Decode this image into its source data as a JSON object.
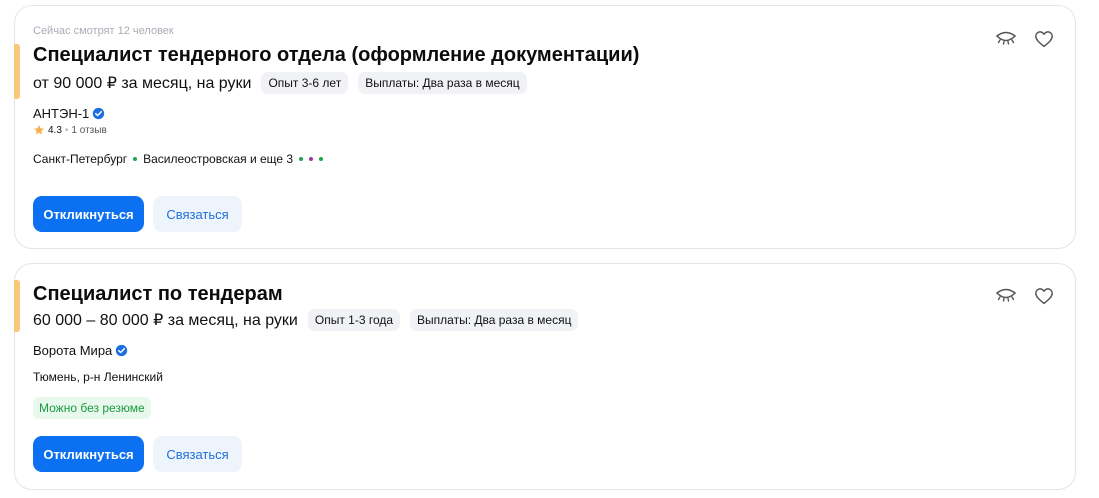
{
  "vacancies": [
    {
      "viewing_now": "Сейчас смотрят 12 человек",
      "title": "Специалист тендерного отдела (оформление документации)",
      "salary": "от 90 000 ₽ за месяц, на руки",
      "experience": "Опыт 3-6 лет",
      "payouts": "Выплаты: Два раза в месяц",
      "company": "АНТЭН-1",
      "rating": "4.3",
      "reviews": "1 отзыв",
      "city": "Санкт-Петербург",
      "metro": "Василеостровская и еще 3",
      "metro_colors": [
        "#21a645",
        "#21a645",
        "#9b3a9c",
        "#21a645"
      ],
      "apply_label": "Откликнуться",
      "contact_label": "Связаться"
    },
    {
      "title": "Специалист по тендерам",
      "salary": "60 000 – 80 000 ₽ за месяц, на руки",
      "experience": "Опыт 1-3 года",
      "payouts": "Выплаты: Два раза в месяц",
      "company": "Ворота Мира",
      "address": "Тюмень, р-н Ленинский",
      "tag": "Можно без резюме",
      "apply_label": "Откликнуться",
      "contact_label": "Связаться"
    }
  ],
  "colors": {
    "accent_bar": "#fbc77a",
    "primary_button": "#0b70f2",
    "secondary_button": "#edf4fc",
    "verified": "#1d6fe0",
    "star": "#f6b04c"
  },
  "icons": {
    "hide": "eye-closed-icon",
    "favorite": "heart-icon",
    "verified": "verified-check-icon",
    "rating": "star-icon"
  }
}
